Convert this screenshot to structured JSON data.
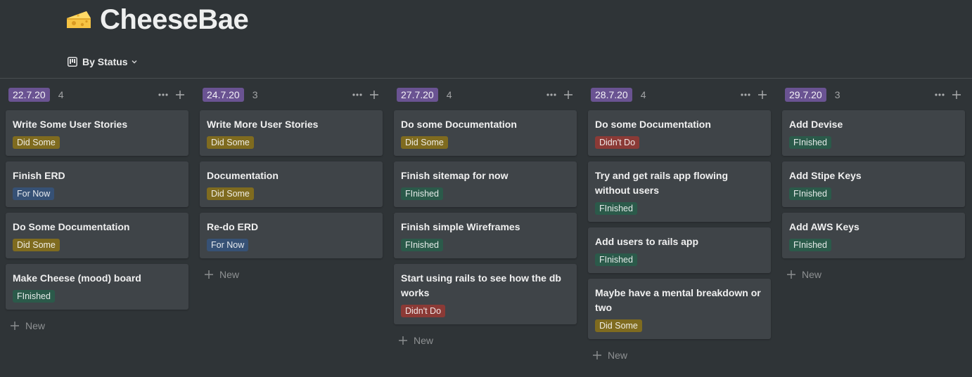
{
  "page": {
    "title": "CheeseBae",
    "view_label": "By Status"
  },
  "colors": {
    "Did Some": "#7f6b1f",
    "For Now": "#365175",
    "FInished": "#2b5a4a",
    "Didn't Do": "#8b3a36",
    "column_tag": "#6a5392"
  },
  "icons": {
    "page": "cheese-icon",
    "view": "board-view-icon",
    "dropdown": "chevron-down-icon",
    "more": "more-options-icon",
    "add": "plus-icon"
  },
  "new_label": "New",
  "columns": [
    {
      "label": "22.7.20",
      "count": "4",
      "cards": [
        {
          "title": "Write Some User Stories",
          "tag": "Did Some"
        },
        {
          "title": "Finish ERD",
          "tag": "For Now"
        },
        {
          "title": "Do Some Documentation",
          "tag": "Did Some"
        },
        {
          "title": "Make Cheese (mood) board",
          "tag": "FInished"
        }
      ]
    },
    {
      "label": "24.7.20",
      "count": "3",
      "cards": [
        {
          "title": "Write More User Stories",
          "tag": "Did Some"
        },
        {
          "title": "Documentation",
          "tag": "Did Some"
        },
        {
          "title": "Re-do ERD",
          "tag": "For Now"
        }
      ]
    },
    {
      "label": "27.7.20",
      "count": "4",
      "cards": [
        {
          "title": "Do some Documentation",
          "tag": "Did Some"
        },
        {
          "title": "Finish sitemap for now",
          "tag": "FInished"
        },
        {
          "title": "Finish simple Wireframes",
          "tag": "FInished"
        },
        {
          "title": "Start using rails to see how the db works",
          "tag": "Didn't Do"
        }
      ]
    },
    {
      "label": "28.7.20",
      "count": "4",
      "cards": [
        {
          "title": "Do some Documentation",
          "tag": "Didn't Do"
        },
        {
          "title": "Try and get rails app flowing without users",
          "tag": "FInished"
        },
        {
          "title": "Add users to rails app",
          "tag": "FInished"
        },
        {
          "title": "Maybe have a mental breakdown or two",
          "tag": "Did Some"
        }
      ]
    },
    {
      "label": "29.7.20",
      "count": "3",
      "cards": [
        {
          "title": "Add Devise",
          "tag": "FInished"
        },
        {
          "title": "Add Stipe Keys",
          "tag": "FInished"
        },
        {
          "title": "Add AWS Keys",
          "tag": "FInished"
        }
      ]
    }
  ]
}
